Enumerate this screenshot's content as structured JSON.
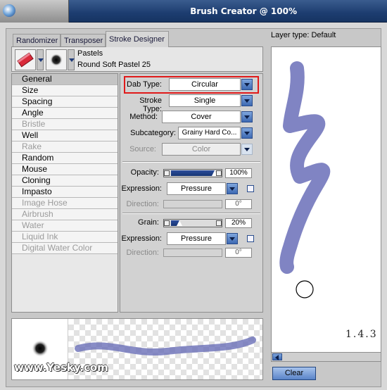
{
  "window": {
    "title": "Brush Creator @ 100%"
  },
  "tabs": [
    {
      "label": "Randomizer"
    },
    {
      "label": "Transposer"
    },
    {
      "label": "Stroke Designer"
    }
  ],
  "brush": {
    "category": "Pastels",
    "variant": "Round Soft Pastel 25"
  },
  "categories": [
    {
      "label": "General"
    },
    {
      "label": "Size"
    },
    {
      "label": "Spacing"
    },
    {
      "label": "Angle"
    },
    {
      "label": "Bristle"
    },
    {
      "label": "Well"
    },
    {
      "label": "Rake"
    },
    {
      "label": "Random"
    },
    {
      "label": "Mouse"
    },
    {
      "label": "Cloning"
    },
    {
      "label": "Impasto"
    },
    {
      "label": "Image Hose"
    },
    {
      "label": "Airbrush"
    },
    {
      "label": "Water"
    },
    {
      "label": "Liquid Ink"
    },
    {
      "label": "Digital Water Color"
    }
  ],
  "settings": {
    "dab_type": {
      "label": "Dab Type:",
      "value": "Circular"
    },
    "stroke_type": {
      "label": "Stroke Type:",
      "value": "Single"
    },
    "method": {
      "label": "Method:",
      "value": "Cover"
    },
    "subcategory": {
      "label": "Subcategory:",
      "value": "Grainy Hard Co..."
    },
    "source": {
      "label": "Source:",
      "value": "Color"
    },
    "opacity": {
      "label": "Opacity:",
      "value": "100%",
      "level": 1.0
    },
    "expression1": {
      "label": "Expression:",
      "value": "Pressure"
    },
    "direction1": {
      "label": "Direction:",
      "value": "0°"
    },
    "grain": {
      "label": "Grain:",
      "value": "20%",
      "level": 0.2
    },
    "expression2": {
      "label": "Expression:",
      "value": "Pressure"
    },
    "direction2": {
      "label": "Direction:",
      "value": "0°"
    }
  },
  "right_panel": {
    "layer_type": "Layer type: Default",
    "version": "1.4.3",
    "clear_label": "Clear"
  },
  "watermark": "www.Yesky.com",
  "colors": {
    "stroke": "#6a6fb8",
    "highlight": "#e01a1a",
    "titlebar": "#1d3d70"
  }
}
